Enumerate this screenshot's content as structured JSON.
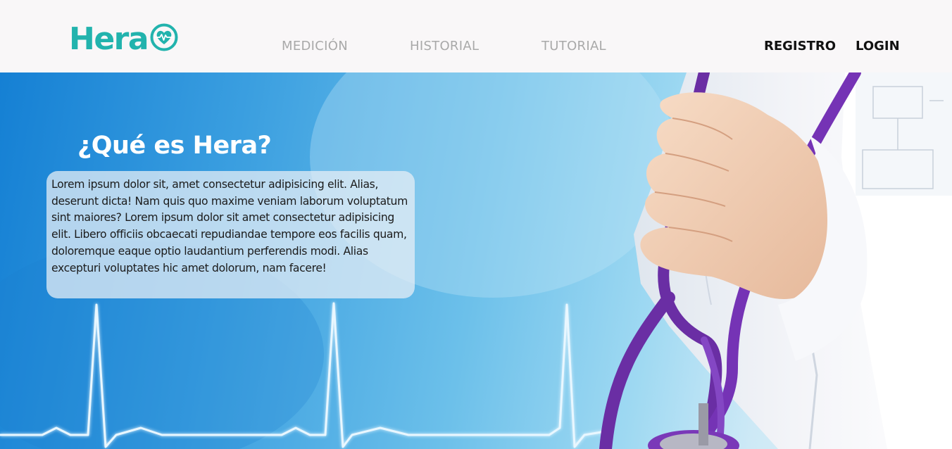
{
  "brand": {
    "name": "Hera",
    "color": "#22b3ad"
  },
  "nav": {
    "items": [
      {
        "label": "MEDICIÓN"
      },
      {
        "label": "HISTORIAL"
      },
      {
        "label": "TUTORIAL"
      }
    ],
    "registro_label": "REGISTRO",
    "login_label": "LOGIN"
  },
  "hero": {
    "title": "¿Qué es Hera?",
    "body": "Lorem ipsum dolor sit, amet consectetur adipisicing elit. Alias, deserunt dicta! Nam quis quo maxime veniam laborum voluptatum sint maiores? Lorem ipsum dolor sit amet consectetur adipisicing elit. Libero officiis obcaecati repudiandae tempore eos facilis quam, doloremque eaque optio laudantium perferendis modi. Alias excepturi voluptates hic amet dolorum, nam facere!"
  },
  "icons": {
    "logo": "heart-pulse-icon"
  }
}
